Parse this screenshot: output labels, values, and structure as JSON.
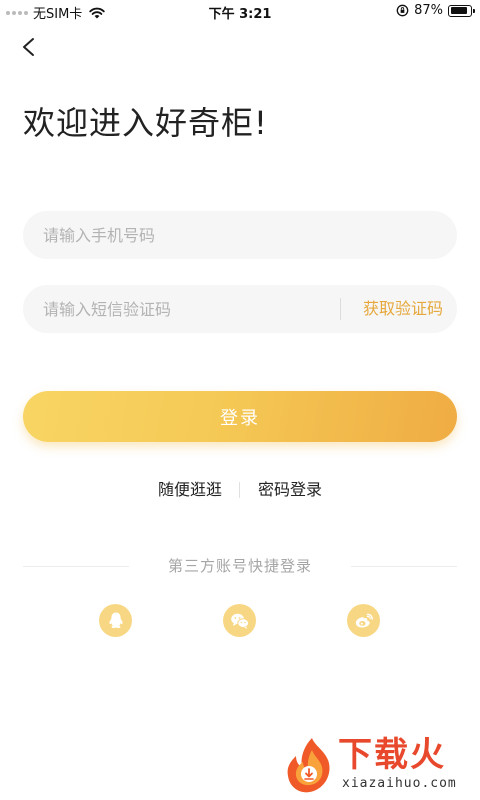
{
  "status_bar": {
    "carrier": "无SIM卡",
    "time": "下午 3:21",
    "battery": "87%",
    "battery_level": 0.87
  },
  "header": {
    "back_icon": "chevron-left-icon",
    "title": "欢迎进入好奇柜!"
  },
  "form": {
    "phone_placeholder": "请输入手机号码",
    "code_placeholder": "请输入短信验证码",
    "get_code_label": "获取验证码",
    "login_label": "登录"
  },
  "links": {
    "browse": "随便逛逛",
    "password_login": "密码登录"
  },
  "third_party": {
    "title": "第三方账号快捷登录",
    "providers": [
      "qq-icon",
      "wechat-icon",
      "weibo-icon"
    ]
  },
  "watermark": {
    "logo_text": "下载火",
    "url": "xiazaihuo.com"
  },
  "colors": {
    "accent": "#e6a83c",
    "button_start": "#f8d564",
    "button_end": "#efac43",
    "social_bg": "#f7d783"
  }
}
